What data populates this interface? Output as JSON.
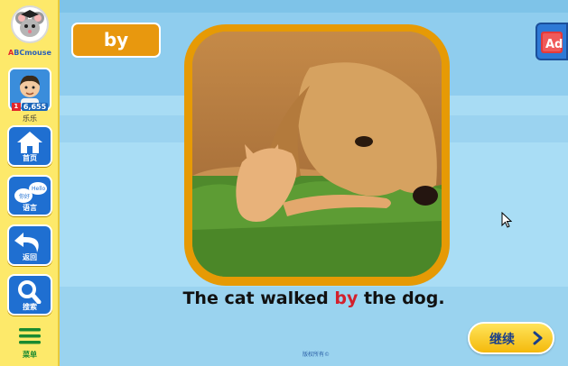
{
  "sidebar": {
    "logo_prefix": "A",
    "logo_mid": "BC",
    "logo_suffix": "mouse",
    "profile": {
      "points": "6,655",
      "level_badge": "1",
      "name": "乐乐"
    },
    "items": [
      {
        "label": "首页",
        "icon": "home-icon"
      },
      {
        "label": "语言",
        "icon": "language-icon",
        "bubble_text": "Hello"
      },
      {
        "label": "返回",
        "icon": "back-arrow-icon"
      },
      {
        "label": "搜索",
        "icon": "search-icon"
      }
    ],
    "menu_label": "菜单"
  },
  "lesson": {
    "word": "by",
    "sentence_before": "The cat walked ",
    "sentence_highlight": "by",
    "sentence_after": " the dog.",
    "image_alt": "golden retriever lying in grass with an orange kitten",
    "continue_label": "继续",
    "ad_button_label": "Ad",
    "footer_text": "版权所有©"
  },
  "colors": {
    "sidebar_bg": "#fde96a",
    "accent_orange": "#e8980e",
    "nav_blue": "#1f6fd1",
    "highlight_red": "#d3202c",
    "continue_yellow": "#f4b90c"
  }
}
